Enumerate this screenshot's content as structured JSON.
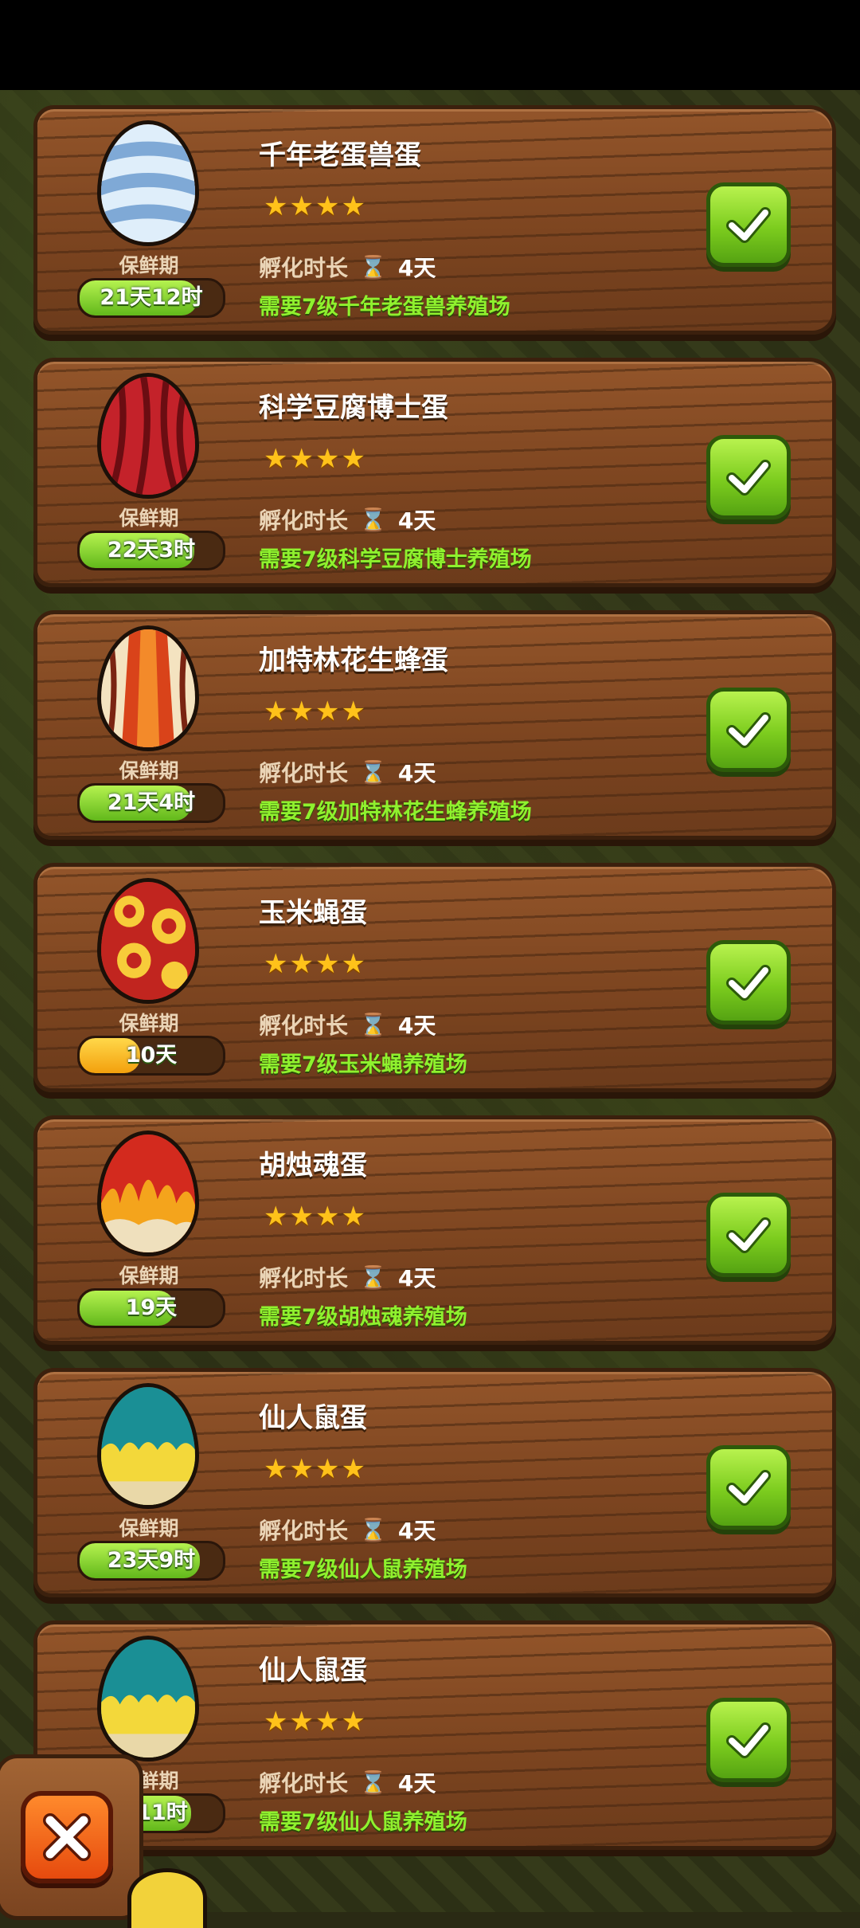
{
  "eggs": [
    {
      "name": "千年老蛋兽蛋",
      "stars": 4,
      "fresh_label": "保鲜期",
      "fresh_value": "21天12时",
      "fresh_fraction": 0.82,
      "fresh_color": "green",
      "hatch_label": "孵化时长",
      "hatch_value": "4天",
      "requirement": "需要7级千年老蛋兽养殖场",
      "pattern": "blue-stripe"
    },
    {
      "name": "科学豆腐博士蛋",
      "stars": 4,
      "fresh_label": "保鲜期",
      "fresh_value": "22天3时",
      "fresh_fraction": 0.8,
      "fresh_color": "green",
      "hatch_label": "孵化时长",
      "hatch_value": "4天",
      "requirement": "需要7级科学豆腐博士养殖场",
      "pattern": "red-tentacle"
    },
    {
      "name": "加特林花生蜂蛋",
      "stars": 4,
      "fresh_label": "保鲜期",
      "fresh_value": "21天4时",
      "fresh_fraction": 0.78,
      "fresh_color": "green",
      "hatch_label": "孵化时长",
      "hatch_value": "4天",
      "requirement": "需要7级加特林花生蜂养殖场",
      "pattern": "orange-drip"
    },
    {
      "name": "玉米蝇蛋",
      "stars": 4,
      "fresh_label": "保鲜期",
      "fresh_value": "10天",
      "fresh_fraction": 0.42,
      "fresh_color": "yellow",
      "hatch_label": "孵化时长",
      "hatch_value": "4天",
      "requirement": "需要7级玉米蝇养殖场",
      "pattern": "gold-swirl"
    },
    {
      "name": "胡烛魂蛋",
      "stars": 4,
      "fresh_label": "保鲜期",
      "fresh_value": "19天",
      "fresh_fraction": 0.66,
      "fresh_color": "green",
      "hatch_label": "孵化时长",
      "hatch_value": "4天",
      "requirement": "需要7级胡烛魂养殖场",
      "pattern": "flame"
    },
    {
      "name": "仙人鼠蛋",
      "stars": 4,
      "fresh_label": "保鲜期",
      "fresh_value": "23天9时",
      "fresh_fraction": 0.84,
      "fresh_color": "green",
      "hatch_label": "孵化时长",
      "hatch_value": "4天",
      "requirement": "需要7级仙人鼠养殖场",
      "pattern": "teal-yellow"
    },
    {
      "name": "仙人鼠蛋",
      "stars": 4,
      "fresh_label": "保鲜期",
      "fresh_value": "天11时",
      "fresh_fraction": 0.78,
      "fresh_color": "green",
      "hatch_label": "孵化时长",
      "hatch_value": "4天",
      "requirement": "需要7级仙人鼠养殖场",
      "pattern": "teal-yellow"
    }
  ],
  "icons": {
    "select": "checkmark-icon",
    "close": "close-icon",
    "hatch": "hourglass-icon",
    "star": "star-icon"
  },
  "colors": {
    "wood": "#7d4520",
    "accent_green": "#8ff12e",
    "check_green": "#7ccc1e",
    "close_orange": "#e64a0e",
    "star": "#ffc21a"
  }
}
